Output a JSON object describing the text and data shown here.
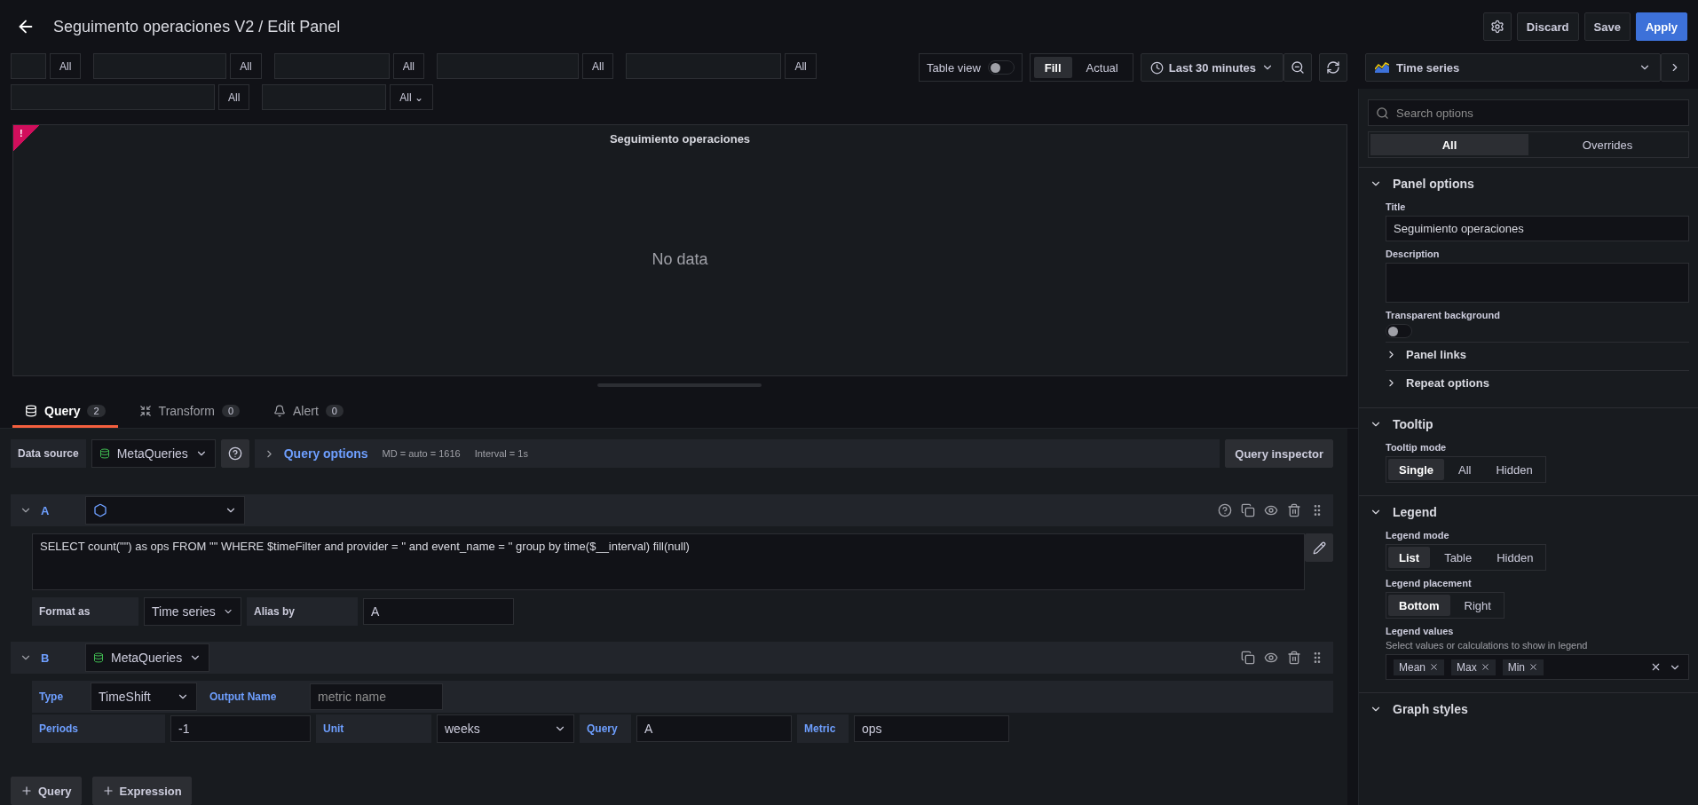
{
  "header": {
    "title": "Seguimento operaciones V2 / Edit Panel",
    "buttons": [
      {
        "label": "Discard",
        "kind": "secondary"
      },
      {
        "label": "Save",
        "kind": "secondary"
      },
      {
        "label": "Apply",
        "kind": "primary"
      }
    ]
  },
  "variables": [
    {
      "value": "All"
    },
    {
      "value": "All"
    },
    {
      "value": "All"
    },
    {
      "value": "All"
    },
    {
      "value": "All"
    },
    {
      "value": "All"
    },
    {
      "value": "All ⌄"
    }
  ],
  "toolbar": {
    "table_view": {
      "label": "Table view",
      "on": false
    },
    "size_modes": [
      {
        "label": "Fill",
        "selected": true
      },
      {
        "label": "Actual",
        "selected": false
      }
    ],
    "time_range": "Last 30 minutes",
    "visualization": "Time series"
  },
  "panel": {
    "title": "Seguimiento operaciones",
    "error": true,
    "error_mark": "!",
    "message": "No data"
  },
  "tabs": [
    {
      "label": "Query",
      "count": "2",
      "selected": true
    },
    {
      "label": "Transform",
      "count": "0",
      "selected": false
    },
    {
      "label": "Alert",
      "count": "0",
      "selected": false
    }
  ],
  "data_source": {
    "label": "Data source",
    "value": "MetaQueries",
    "options_label": "Query options",
    "md": "MD = auto = 1616",
    "interval": "Interval = 1s",
    "inspector": "Query inspector"
  },
  "queries": [
    {
      "kind": "sql",
      "letter": "A",
      "sql": "SELECT count(\"\")  as ops FROM \"\" WHERE $timeFilter and provider = '' and event_name = '' group by time($__interval) fill(null)",
      "format_label": "Format as",
      "format": "Time series",
      "alias_label": "Alias by",
      "alias": "A"
    },
    {
      "kind": "meta",
      "letter": "B",
      "source": "MetaQueries",
      "type_label": "Type",
      "type": "TimeShift",
      "output_label": "Output Name",
      "output_placeholder": "metric name",
      "periods_label": "Periods",
      "periods": "-1",
      "unit_label": "Unit",
      "unit": "weeks",
      "query_label": "Query",
      "query": "A",
      "metric_label": "Metric",
      "metric": "ops"
    }
  ],
  "add_buttons": [
    "Query",
    "Expression"
  ],
  "options": {
    "search_placeholder": "Search options",
    "tabs": [
      {
        "label": "All",
        "selected": true
      },
      {
        "label": "Overrides",
        "selected": false
      }
    ],
    "sections": [
      {
        "title": "Panel options",
        "expanded": true,
        "fields": [
          {
            "kind": "input",
            "label": "Title",
            "value": "Seguimiento operaciones"
          },
          {
            "kind": "textarea",
            "label": "Description"
          },
          {
            "kind": "switch",
            "label": "Transparent background",
            "on": false
          },
          {
            "kind": "link",
            "label": "Panel links"
          },
          {
            "kind": "link",
            "label": "Repeat options"
          }
        ]
      },
      {
        "title": "Tooltip",
        "expanded": true,
        "fields": [
          {
            "kind": "radio",
            "label": "Tooltip mode",
            "options": [
              {
                "label": "Single",
                "selected": true
              },
              {
                "label": "All",
                "selected": false
              },
              {
                "label": "Hidden",
                "selected": false
              }
            ]
          }
        ]
      },
      {
        "title": "Legend",
        "expanded": true,
        "fields": [
          {
            "kind": "radio",
            "label": "Legend mode",
            "options": [
              {
                "label": "List",
                "selected": true
              },
              {
                "label": "Table",
                "selected": false
              },
              {
                "label": "Hidden",
                "selected": false
              }
            ]
          },
          {
            "kind": "radio",
            "label": "Legend placement",
            "options": [
              {
                "label": "Bottom",
                "selected": true
              },
              {
                "label": "Right",
                "selected": false
              }
            ]
          },
          {
            "kind": "tags",
            "label": "Legend values",
            "hint": "Select values or calculations to show in legend",
            "tags": [
              "Mean",
              "Max",
              "Min"
            ]
          }
        ]
      },
      {
        "title": "Graph styles",
        "expanded": true
      }
    ]
  }
}
